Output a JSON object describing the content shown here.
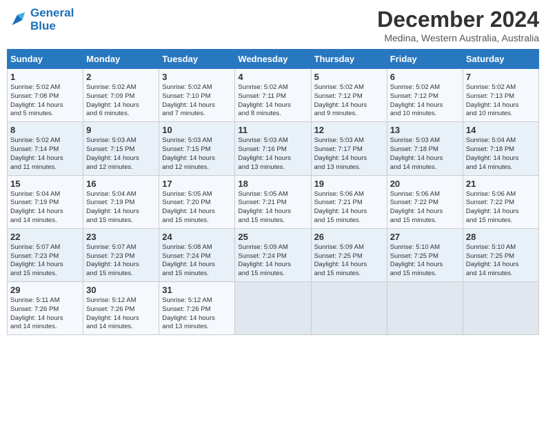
{
  "logo": {
    "line1": "General",
    "line2": "Blue"
  },
  "title": "December 2024",
  "subtitle": "Medina, Western Australia, Australia",
  "headers": [
    "Sunday",
    "Monday",
    "Tuesday",
    "Wednesday",
    "Thursday",
    "Friday",
    "Saturday"
  ],
  "weeks": [
    [
      {
        "day": "1",
        "info": "Sunrise: 5:02 AM\nSunset: 7:08 PM\nDaylight: 14 hours\nand 5 minutes."
      },
      {
        "day": "2",
        "info": "Sunrise: 5:02 AM\nSunset: 7:09 PM\nDaylight: 14 hours\nand 6 minutes."
      },
      {
        "day": "3",
        "info": "Sunrise: 5:02 AM\nSunset: 7:10 PM\nDaylight: 14 hours\nand 7 minutes."
      },
      {
        "day": "4",
        "info": "Sunrise: 5:02 AM\nSunset: 7:11 PM\nDaylight: 14 hours\nand 8 minutes."
      },
      {
        "day": "5",
        "info": "Sunrise: 5:02 AM\nSunset: 7:12 PM\nDaylight: 14 hours\nand 9 minutes."
      },
      {
        "day": "6",
        "info": "Sunrise: 5:02 AM\nSunset: 7:12 PM\nDaylight: 14 hours\nand 10 minutes."
      },
      {
        "day": "7",
        "info": "Sunrise: 5:02 AM\nSunset: 7:13 PM\nDaylight: 14 hours\nand 10 minutes."
      }
    ],
    [
      {
        "day": "8",
        "info": "Sunrise: 5:02 AM\nSunset: 7:14 PM\nDaylight: 14 hours\nand 11 minutes."
      },
      {
        "day": "9",
        "info": "Sunrise: 5:03 AM\nSunset: 7:15 PM\nDaylight: 14 hours\nand 12 minutes."
      },
      {
        "day": "10",
        "info": "Sunrise: 5:03 AM\nSunset: 7:15 PM\nDaylight: 14 hours\nand 12 minutes."
      },
      {
        "day": "11",
        "info": "Sunrise: 5:03 AM\nSunset: 7:16 PM\nDaylight: 14 hours\nand 13 minutes."
      },
      {
        "day": "12",
        "info": "Sunrise: 5:03 AM\nSunset: 7:17 PM\nDaylight: 14 hours\nand 13 minutes."
      },
      {
        "day": "13",
        "info": "Sunrise: 5:03 AM\nSunset: 7:18 PM\nDaylight: 14 hours\nand 14 minutes."
      },
      {
        "day": "14",
        "info": "Sunrise: 5:04 AM\nSunset: 7:18 PM\nDaylight: 14 hours\nand 14 minutes."
      }
    ],
    [
      {
        "day": "15",
        "info": "Sunrise: 5:04 AM\nSunset: 7:19 PM\nDaylight: 14 hours\nand 14 minutes."
      },
      {
        "day": "16",
        "info": "Sunrise: 5:04 AM\nSunset: 7:19 PM\nDaylight: 14 hours\nand 15 minutes."
      },
      {
        "day": "17",
        "info": "Sunrise: 5:05 AM\nSunset: 7:20 PM\nDaylight: 14 hours\nand 15 minutes."
      },
      {
        "day": "18",
        "info": "Sunrise: 5:05 AM\nSunset: 7:21 PM\nDaylight: 14 hours\nand 15 minutes."
      },
      {
        "day": "19",
        "info": "Sunrise: 5:06 AM\nSunset: 7:21 PM\nDaylight: 14 hours\nand 15 minutes."
      },
      {
        "day": "20",
        "info": "Sunrise: 5:06 AM\nSunset: 7:22 PM\nDaylight: 14 hours\nand 15 minutes."
      },
      {
        "day": "21",
        "info": "Sunrise: 5:06 AM\nSunset: 7:22 PM\nDaylight: 14 hours\nand 15 minutes."
      }
    ],
    [
      {
        "day": "22",
        "info": "Sunrise: 5:07 AM\nSunset: 7:23 PM\nDaylight: 14 hours\nand 15 minutes."
      },
      {
        "day": "23",
        "info": "Sunrise: 5:07 AM\nSunset: 7:23 PM\nDaylight: 14 hours\nand 15 minutes."
      },
      {
        "day": "24",
        "info": "Sunrise: 5:08 AM\nSunset: 7:24 PM\nDaylight: 14 hours\nand 15 minutes."
      },
      {
        "day": "25",
        "info": "Sunrise: 5:09 AM\nSunset: 7:24 PM\nDaylight: 14 hours\nand 15 minutes."
      },
      {
        "day": "26",
        "info": "Sunrise: 5:09 AM\nSunset: 7:25 PM\nDaylight: 14 hours\nand 15 minutes."
      },
      {
        "day": "27",
        "info": "Sunrise: 5:10 AM\nSunset: 7:25 PM\nDaylight: 14 hours\nand 15 minutes."
      },
      {
        "day": "28",
        "info": "Sunrise: 5:10 AM\nSunset: 7:25 PM\nDaylight: 14 hours\nand 14 minutes."
      }
    ],
    [
      {
        "day": "29",
        "info": "Sunrise: 5:11 AM\nSunset: 7:26 PM\nDaylight: 14 hours\nand 14 minutes."
      },
      {
        "day": "30",
        "info": "Sunrise: 5:12 AM\nSunset: 7:26 PM\nDaylight: 14 hours\nand 14 minutes."
      },
      {
        "day": "31",
        "info": "Sunrise: 5:12 AM\nSunset: 7:26 PM\nDaylight: 14 hours\nand 13 minutes."
      },
      {
        "day": "",
        "info": ""
      },
      {
        "day": "",
        "info": ""
      },
      {
        "day": "",
        "info": ""
      },
      {
        "day": "",
        "info": ""
      }
    ]
  ]
}
